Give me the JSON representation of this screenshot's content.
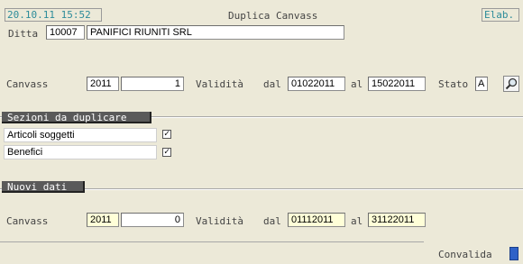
{
  "header": {
    "datetime": "20.10.11 15:52",
    "title": "Duplica Canvass",
    "elab_label": "Elab."
  },
  "ditta": {
    "label": "Ditta",
    "code": "10007",
    "name": "PANIFICI RIUNITI SRL"
  },
  "canvass_row": {
    "label": "Canvass",
    "year": "2011",
    "number": "1",
    "validita_label": "Validità",
    "dal_label": "dal",
    "dal_value": "01022011",
    "al_label": "al",
    "al_value": "15022011",
    "stato_label": "Stato",
    "stato_value": "A"
  },
  "sezioni": {
    "header": "Sezioni da duplicare",
    "items": [
      {
        "label": "Articoli soggetti",
        "checked": "✓"
      },
      {
        "label": "Benefici",
        "checked": "✓"
      }
    ]
  },
  "nuovi": {
    "header": "Nuovi dati",
    "label": "Canvass",
    "year": "2011",
    "number": "0",
    "validita_label": "Validità",
    "dal_label": "dal",
    "dal_value": "01112011",
    "al_label": "al",
    "al_value": "31122011"
  },
  "footer": {
    "convalida_label": "Convalida"
  },
  "colors": {
    "background": "#ece9d8",
    "section_header": "#5a5a5a",
    "accent_teal": "#2d8c9a",
    "convalida_button": "#2f62c8"
  }
}
